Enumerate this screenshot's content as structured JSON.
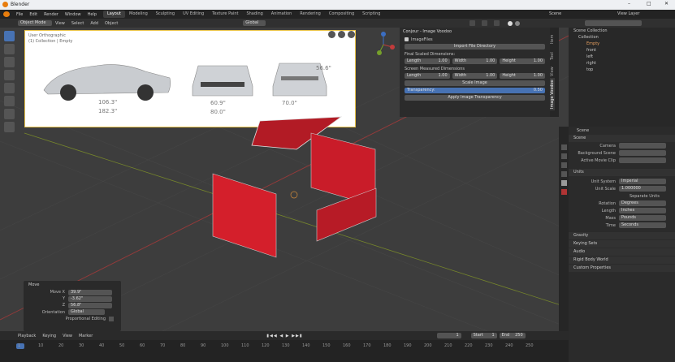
{
  "app": {
    "title": "Blender",
    "window_buttons": [
      "–",
      "□",
      "✕"
    ]
  },
  "menu": [
    "File",
    "Edit",
    "Render",
    "Window",
    "Help"
  ],
  "workspaces": [
    "Layout",
    "Modeling",
    "Sculpting",
    "UV Editing",
    "Texture Paint",
    "Shading",
    "Animation",
    "Rendering",
    "Compositing",
    "Scripting"
  ],
  "active_workspace": "Layout",
  "scene_name": "Scene",
  "view_layer": "View Layer",
  "viewport": {
    "mode": "Object Mode",
    "menus": [
      "View",
      "Select",
      "Add",
      "Object"
    ],
    "transform": "Global",
    "overlay_title": "User Orthographic",
    "overlay_sub": "(1) Collection | Empty",
    "dims": [
      "106.3\"",
      "182.3\"",
      "60.9\"",
      "80.0\"",
      "70.0\"",
      "56.6\""
    ]
  },
  "n_panel": {
    "title": "Conjour - Image Voodoo",
    "image_files": "ImageFiles",
    "import_btn": "Import File Directory",
    "final_dims": "Final Scaled Dimensions:",
    "screen_dims": "Screen Measured Dimensions",
    "final": {
      "length_label": "Length",
      "length": "1.00",
      "width_label": "Width",
      "width": "1.00",
      "height_label": "Height",
      "height": "1.00"
    },
    "screen": {
      "length_label": "Length",
      "length": "1.00",
      "width_label": "Width",
      "width": "1.00",
      "height_label": "Height",
      "height": "1.00"
    },
    "scale_btn": "Scale Image",
    "transparency_label": "Transparency:",
    "transparency": "0.50",
    "apply_btn": "Apply Image Transparency",
    "tabs": [
      "Item",
      "Tool",
      "View",
      "Image Voodoo"
    ]
  },
  "outliner": {
    "root": "Scene Collection",
    "collection": "Collection",
    "items": [
      "Empty",
      "front",
      "left",
      "right",
      "top"
    ]
  },
  "properties": {
    "scene": "Scene",
    "section": "Scene",
    "camera_label": "Camera",
    "bg_scene_label": "Background Scene",
    "movie_clip_label": "Active Movie Clip",
    "units": "Units",
    "unit_system_label": "Unit System",
    "unit_system": "Imperial",
    "unit_scale_label": "Unit Scale",
    "unit_scale": "1.000000",
    "separate_units": "Separate Units",
    "rotation_label": "Rotation",
    "rotation": "Degrees",
    "length_label": "Length",
    "length": "Inches",
    "mass_label": "Mass",
    "mass": "Pounds",
    "time_label": "Time",
    "time": "Seconds",
    "collapsed": [
      "Gravity",
      "Keying Sets",
      "Audio",
      "Rigid Body World",
      "Custom Properties"
    ]
  },
  "move_panel": {
    "title": "Move",
    "move_x_label": "Move X",
    "move_x": "39.9\"",
    "y_label": "Y",
    "y": "-3.62\"",
    "z_label": "Z",
    "z": "56.8\"",
    "orientation_label": "Orientation",
    "orientation": "Global",
    "prop_edit": "Proportional Editing"
  },
  "timeline": {
    "playback": "Playback",
    "keying": "Keying",
    "view": "View",
    "marker": "Marker",
    "current": "1",
    "start_label": "Start",
    "start": "1",
    "end_label": "End",
    "end": "250",
    "ticks": [
      "1",
      "10",
      "20",
      "30",
      "40",
      "50",
      "60",
      "70",
      "80",
      "90",
      "100",
      "110",
      "120",
      "130",
      "140",
      "150",
      "160",
      "170",
      "180",
      "190",
      "200",
      "210",
      "220",
      "230",
      "240",
      "250"
    ]
  },
  "status": [
    "",
    "",
    "",
    "2.83.0"
  ]
}
